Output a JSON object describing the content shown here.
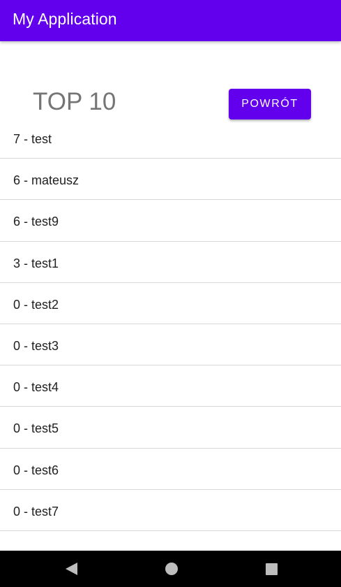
{
  "app_bar": {
    "title": "My Application",
    "color": "#6200ee"
  },
  "header": {
    "title": "TOP 10",
    "back_button_label": "POWRÓT"
  },
  "scores": [
    {
      "text": "7 - test"
    },
    {
      "text": "6 - mateusz"
    },
    {
      "text": "6 - test9"
    },
    {
      "text": "3 - test1"
    },
    {
      "text": "0 - test2"
    },
    {
      "text": "0 - test3"
    },
    {
      "text": "0 - test4"
    },
    {
      "text": "0 - test5"
    },
    {
      "text": "0 - test6"
    },
    {
      "text": "0 - test7"
    }
  ],
  "nav_bar": {
    "icons": [
      "back-icon",
      "home-icon",
      "recents-icon"
    ]
  }
}
